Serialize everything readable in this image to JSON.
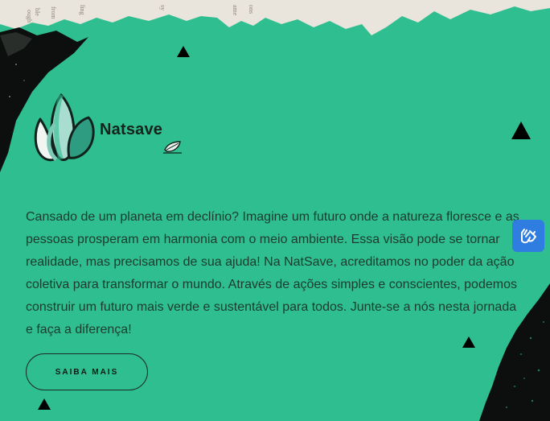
{
  "brand": {
    "name": "Natsave"
  },
  "hero": {
    "description": "Cansado de um planeta em declínio? Imagine um futuro onde a natureza floresce e as pessoas prosperam em harmonia com o meio ambiente. Essa visão pode se tornar realidade, mas precisamos de sua ajuda! Na NatSave, acreditamos no poder da ação coletiva para transformar o mundo. Através de ações simples e conscientes, podemos construir um futuro mais verde e sustentável para todos. Junte-se a nós nesta jornada e faça a diferença!",
    "cta_label": "SAIBA MAIS"
  },
  "colors": {
    "background": "#2fbe8f",
    "accessibility_button": "#2f7de1",
    "text": "#1c3b2e"
  },
  "icons": {
    "logo": "lotus-leaves-icon",
    "badge": "leaf-badge-icon",
    "accessibility": "sign-language-hands-icon"
  }
}
